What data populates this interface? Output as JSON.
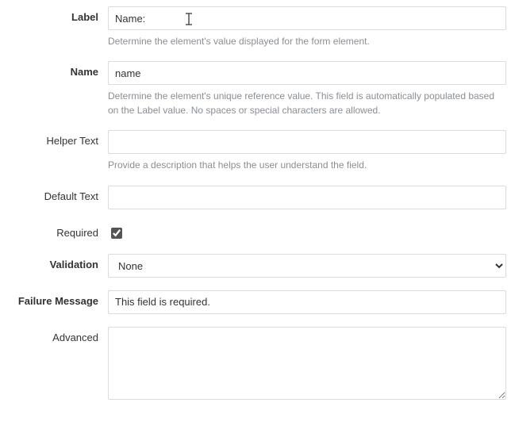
{
  "fields": {
    "label": {
      "title": "Label",
      "value": "Name:",
      "help": "Determine the element's value displayed for the form element."
    },
    "name": {
      "title": "Name",
      "value": "name",
      "help": "Determine the element's unique reference value. This field is automatically populated based on the Label value. No spaces or special characters are allowed."
    },
    "helper_text": {
      "title": "Helper Text",
      "value": "",
      "help": "Provide a description that helps the user understand the field."
    },
    "default_text": {
      "title": "Default Text",
      "value": ""
    },
    "required": {
      "title": "Required",
      "checked": true
    },
    "validation": {
      "title": "Validation",
      "selected": "None"
    },
    "failure_message": {
      "title": "Failure Message",
      "value": "This field is required."
    },
    "advanced": {
      "title": "Advanced",
      "value": ""
    }
  }
}
